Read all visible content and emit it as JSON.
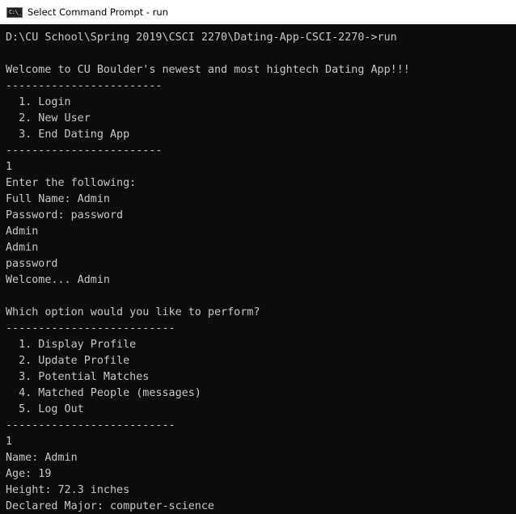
{
  "window": {
    "title": "Select Command Prompt - run",
    "icon": "cmd-icon",
    "icon_text": "C:\\_"
  },
  "console": {
    "lines": [
      "D:\\CU School\\Spring 2019\\CSCI 2270\\Dating-App-CSCI-2270->run",
      "",
      "Welcome to CU Boulder's newest and most hightech Dating App!!!",
      "------------------------",
      "  1. Login",
      "  2. New User",
      "  3. End Dating App",
      "------------------------",
      "1",
      "Enter the following:",
      "Full Name: Admin",
      "Password: password",
      "Admin",
      "Admin",
      "password",
      "Welcome... Admin",
      "",
      "Which option would you like to perform?",
      "--------------------------",
      "  1. Display Profile",
      "  2. Update Profile",
      "  3. Potential Matches",
      "  4. Matched People (messages)",
      "  5. Log Out",
      "--------------------------",
      "1",
      "Name: Admin",
      "Age: 19",
      "Height: 72.3 inches",
      "Declared Major: computer-science"
    ]
  }
}
